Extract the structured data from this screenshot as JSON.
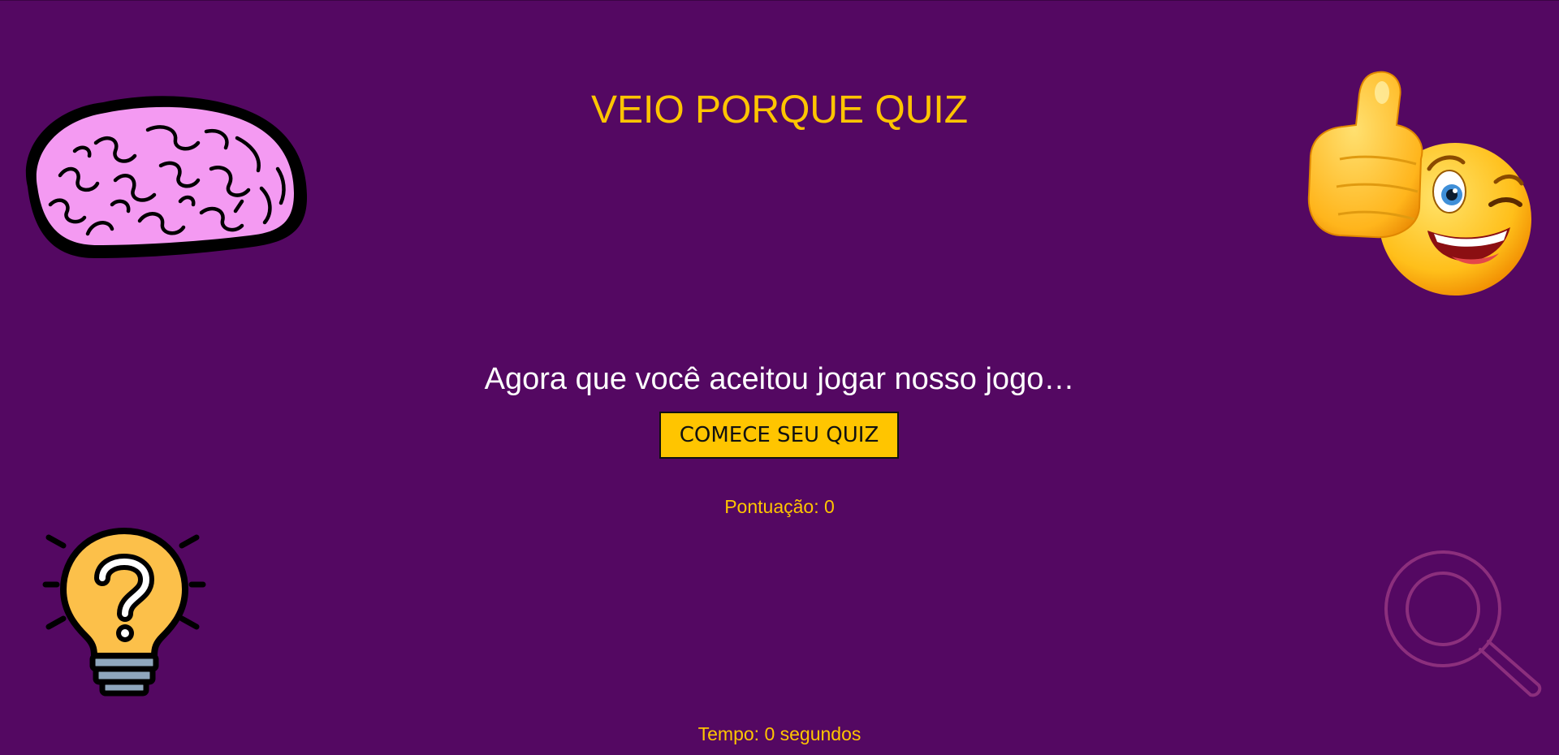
{
  "header": {
    "title": "VEIO PORQUE QUIZ"
  },
  "intro": {
    "text": "Agora que você aceitou jogar nosso jogo…",
    "start_button_label": "COMECE SEU QUIZ"
  },
  "status": {
    "score_text": "Pontuação: 0",
    "time_text": "Tempo: 0 segundos"
  },
  "decorations": {
    "top_left": "brain-icon",
    "top_right": "thumbs-up-wink-emoji-icon",
    "bottom_left": "question-lightbulb-icon",
    "bottom_right": "magnifier-icon"
  },
  "colors": {
    "background": "#540862",
    "accent": "#ffc500",
    "text": "#ffffff"
  }
}
